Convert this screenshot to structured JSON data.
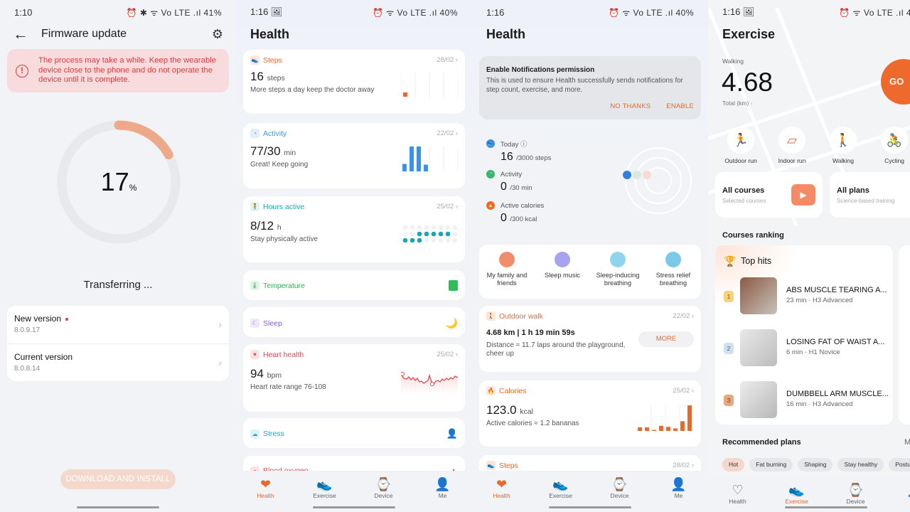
{
  "firmware": {
    "status_time": "1:10",
    "status_right": "⏰ ✱ ᯤ Vo LTE .ıl 41%",
    "title": "Firmware update",
    "warning": "The process may take a while. Keep the wearable device close to the phone and do not operate the device until it is complete.",
    "progress_percent": 17,
    "progress_value": "17",
    "progress_unit": "%",
    "status_text": "Transferring ...",
    "new_version_label": "New version",
    "new_version_value": "8.0.9.17",
    "current_version_label": "Current version",
    "current_version_value": "8.0.8.14",
    "download_button": "DOWNLOAD AND INSTALL"
  },
  "health1": {
    "status_time": "1:16 🖼",
    "status_right": "⏰ ᯤ Vo LTE .ıl 40%",
    "title": "Health",
    "steps": {
      "label": "Steps",
      "date": "28/02",
      "value": "16",
      "unit": "steps",
      "sub": "More steps a day keep the doctor away",
      "color": "#e8692d"
    },
    "activity": {
      "label": "Activity",
      "date": "22/02",
      "value": "77/30",
      "unit": "min",
      "sub": "Great! Keep going",
      "color": "#3b93e6",
      "bars": [
        0.3,
        1.0,
        1.0,
        0.27,
        0,
        0,
        0,
        0
      ]
    },
    "hours": {
      "label": "Hours active",
      "date": "25/02",
      "value": "8/12",
      "unit": "h",
      "sub": "Stay physically active",
      "color": "#17a7b5",
      "active_hours": 8,
      "goal_hours": 12
    },
    "temperature": {
      "label": "Temperature",
      "color": "#2fb35a"
    },
    "sleep": {
      "label": "Sleep",
      "color": "#8a5ae0"
    },
    "heart": {
      "label": "Heart health",
      "date": "25/02",
      "value": "94",
      "unit": "bpm",
      "sub": "Heart rate range 76-108",
      "color": "#e0484e"
    },
    "stress": {
      "label": "Stress",
      "color": "#17a7c8"
    },
    "oxygen": {
      "label": "Blood oxygen",
      "color": "#e0484e"
    }
  },
  "health2": {
    "status_time": "1:16",
    "status_right": "⏰ ᯤ Vo LTE .ıl 40%",
    "title": "Health",
    "notif_title": "Enable Notifications permission",
    "notif_desc": "This is used to ensure Health successfully sends notifications for step count, exercise, and more.",
    "notif_no": "NO THANKS",
    "notif_yes": "ENABLE",
    "today_label": "Today ⓘ",
    "today_value": "16",
    "today_goal": "/3000 steps",
    "activity_label": "Activity",
    "activity_value": "0",
    "activity_goal": "/30 min",
    "cal_label": "Active calories",
    "cal_value": "0",
    "cal_goal": "/300 kcal",
    "tools": [
      {
        "label": "My family and friends",
        "color": "#f28c6a"
      },
      {
        "label": "Sleep music",
        "color": "#8f8ae6"
      },
      {
        "label": "Sleep-inducing breathing",
        "color": "#6cc7e6"
      },
      {
        "label": "Stress relief breathing",
        "color": "#5ab9dc"
      }
    ],
    "walk": {
      "label": "Outdoor walk",
      "date": "22/02",
      "value": "4.68 km | 1 h 19 min 59s",
      "sub": "Distance ≈ 11.7 laps around the playground, cheer up",
      "more": "MORE"
    },
    "calories": {
      "label": "Calories",
      "date": "25/02",
      "value": "123.0",
      "unit": "kcal",
      "sub": "Active calories ≈ 1.2 bananas",
      "bars": [
        0.14,
        0.14,
        0.04,
        0.2,
        0.16,
        0.1,
        0.38,
        1.0
      ]
    },
    "steps_peek": {
      "label": "Steps",
      "date": "28/02"
    }
  },
  "exercise": {
    "status_time": "1:16 🖼",
    "status_right": "⏰ ᯤ Vo LTE .ıl 4",
    "title": "Exercise",
    "mode": "Walking",
    "distance": "4.68",
    "total_label": "Total (km)",
    "go": "GO",
    "types": [
      {
        "label": "Outdoor run",
        "icon": "🏃"
      },
      {
        "label": "Indoor run",
        "icon": "▱"
      },
      {
        "label": "Walking",
        "icon": "🚶"
      },
      {
        "label": "Cycling",
        "icon": "🚴"
      }
    ],
    "all_courses": "All courses",
    "all_courses_sub": "Selected courses",
    "all_plans": "All plans",
    "all_plans_sub": "Science-based training",
    "ranking_title": "Courses ranking",
    "top_hits": "Top hits",
    "courses": [
      {
        "rank": "1",
        "name": "ABS MUSCLE TEARING A...",
        "meta": "23 min · H3 Advanced"
      },
      {
        "rank": "2",
        "name": "LOSING FAT OF WAIST A...",
        "meta": "6 min · H1 Novice"
      },
      {
        "rank": "3",
        "name": "DUMBBELL ARM MUSCLE...",
        "meta": "16 min · H3 Advanced"
      }
    ],
    "recommended": "Recommended plans",
    "more_cut": "M",
    "chips": [
      "Hot",
      "Fat burning",
      "Shaping",
      "Stay healthy",
      "Posture"
    ]
  },
  "nav": {
    "health": "Health",
    "exercise": "Exercise",
    "device": "Device",
    "me": "Me"
  },
  "colors": {
    "accent": "#e8692d",
    "warning": "#e0383e"
  }
}
